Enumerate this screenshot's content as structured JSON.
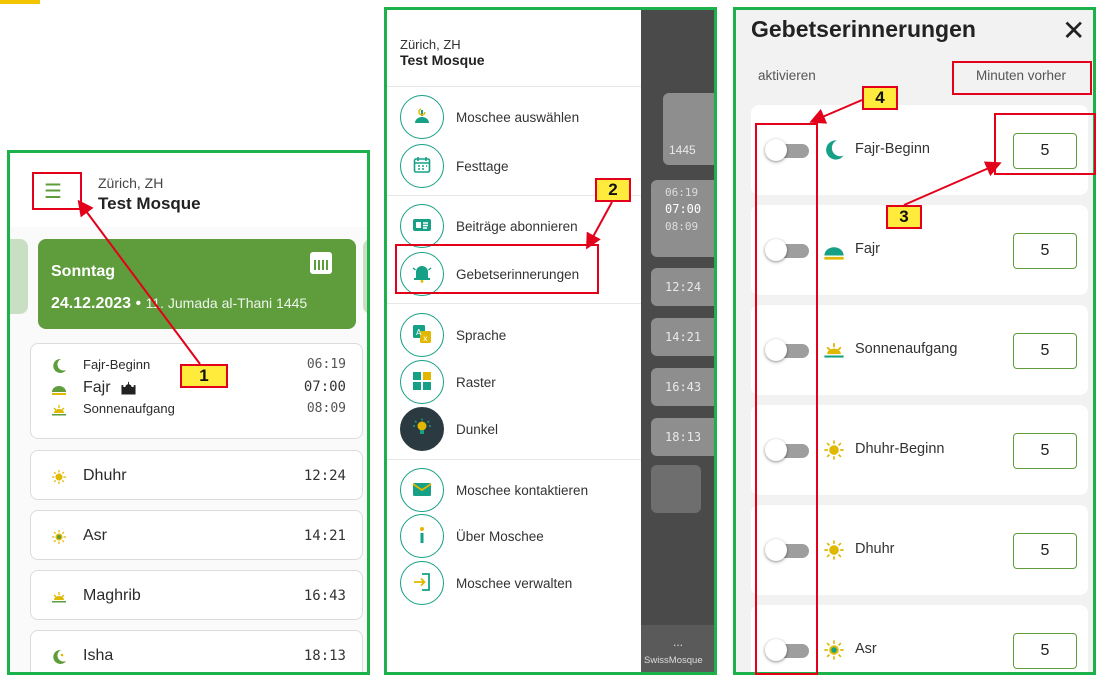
{
  "colors": {
    "frame": "#1db14b",
    "accent": "#5e9c3c",
    "teal": "#16a085",
    "callout_bg": "#ffeb3b",
    "callout_border": "#e3001b"
  },
  "callouts": [
    "1",
    "2",
    "3",
    "4"
  ],
  "panel1": {
    "header": {
      "menu_icon": "hamburger-icon",
      "city": "Zürich, ZH",
      "mosque": "Test Mosque"
    },
    "day_card": {
      "day": "Sonntag",
      "date": "24.12.2023",
      "hijri": "11. Jumada al-Thani 1445",
      "icon": "calendar-icon"
    },
    "group": [
      {
        "name": "Fajr-Beginn",
        "time": "06:19",
        "icon": "crescent-icon"
      },
      {
        "name": "Fajr",
        "time": "07:00",
        "icon": "dawn-icon",
        "extra_icon": "mosque-icon"
      },
      {
        "name": "Sonnenaufgang",
        "time": "08:09",
        "icon": "sunrise-icon"
      }
    ],
    "prayers": [
      {
        "name": "Dhuhr",
        "time": "12:24",
        "icon": "sun-icon"
      },
      {
        "name": "Asr",
        "time": "14:21",
        "icon": "sun-icon"
      },
      {
        "name": "Maghrib",
        "time": "16:43",
        "icon": "sunset-icon"
      },
      {
        "name": "Isha",
        "time": "18:13",
        "icon": "moon-icon"
      }
    ]
  },
  "panel2": {
    "city": "Zürich, ZH",
    "mosque": "Test Mosque",
    "menu": [
      {
        "label": "Moschee auswählen",
        "icon": "mosque-select-icon"
      },
      {
        "label": "Festtage",
        "icon": "calendar-icon"
      },
      {
        "label": "Beiträge abonnieren",
        "icon": "subscribe-icon"
      },
      {
        "label": "Gebetserinnerungen",
        "icon": "bell-icon"
      },
      {
        "label": "Sprache",
        "icon": "language-icon"
      },
      {
        "label": "Raster",
        "icon": "grid-icon"
      },
      {
        "label": "Dunkel",
        "icon": "bulb-icon"
      },
      {
        "label": "Moschee kontaktieren",
        "icon": "mail-icon"
      },
      {
        "label": "Über Moschee",
        "icon": "info-icon"
      },
      {
        "label": "Moschee verwalten",
        "icon": "login-icon"
      }
    ],
    "background": {
      "hijri_tail": "1445",
      "times_group": [
        "06:19",
        "07:00",
        "08:09"
      ],
      "times": [
        "12:24",
        "14:21",
        "16:43",
        "18:13"
      ],
      "more": "...",
      "footer": "SwissMosque"
    }
  },
  "panel3": {
    "title": "Gebetserinnerungen",
    "close_icon": "close-icon",
    "col_activate": "aktivieren",
    "col_minutes": "Minuten vorher",
    "rows": [
      {
        "label": "Fajr-Beginn",
        "minutes": "5",
        "enabled": false,
        "icon": "crescent-icon"
      },
      {
        "label": "Fajr",
        "minutes": "5",
        "enabled": false,
        "icon": "dawn-icon"
      },
      {
        "label": "Sonnenaufgang",
        "minutes": "5",
        "enabled": false,
        "icon": "sunrise-icon"
      },
      {
        "label": "Dhuhr-Beginn",
        "minutes": "5",
        "enabled": false,
        "icon": "sun-icon"
      },
      {
        "label": "Dhuhr",
        "minutes": "5",
        "enabled": false,
        "icon": "sun-icon"
      },
      {
        "label": "Asr",
        "minutes": "5",
        "enabled": false,
        "icon": "sun-icon"
      }
    ]
  }
}
